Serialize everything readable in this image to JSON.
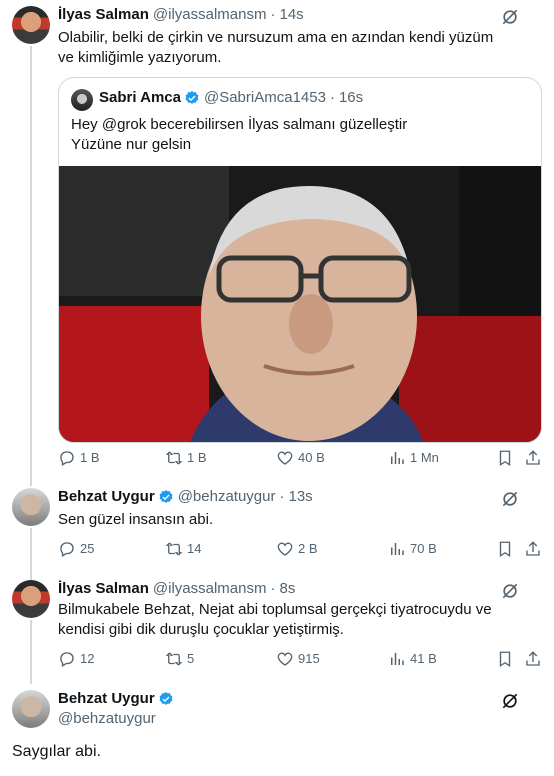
{
  "colors": {
    "text": "#0f1419",
    "secondary": "#536471",
    "border": "#cfd9de",
    "verified": "#1d9bf0"
  },
  "tweets": [
    {
      "name": "İlyas Salman",
      "handle": "@ilyassalmansm",
      "dot": "·",
      "time": "14s",
      "text": "Olabilir, belki de çirkin ve nursuzum ama en azından kendi yüzüm ve kimliğimle yazıyorum.",
      "quote": {
        "name": "Sabri Amca",
        "handle": "@SabriAmca1453",
        "dot": "·",
        "time": "16s",
        "line1": "Hey @grok becerebilirsen  İlyas salmanı güzelleştir",
        "line2": "Yüzüne nur gelsin"
      },
      "stats": {
        "replies": "1 B",
        "reposts": "1 B",
        "likes": "40 B",
        "views": "1 Mn"
      }
    },
    {
      "name": "Behzat Uygur",
      "handle": "@behzatuygur",
      "dot": "·",
      "time": "13s",
      "text": "Sen güzel insansın abi.",
      "stats": {
        "replies": "25",
        "reposts": "14",
        "likes": "2 B",
        "views": "70 B"
      }
    },
    {
      "name": "İlyas Salman",
      "handle": "@ilyassalmansm",
      "dot": "·",
      "time": "8s",
      "text": "Bilmukabele Behzat, Nejat abi toplumsal gerçekçi tiyatrocuydu ve kendisi gibi dik duruşlu çocuklar yetiştirmiş.",
      "stats": {
        "replies": "12",
        "reposts": "5",
        "likes": "915",
        "views": "41 B"
      }
    },
    {
      "name": "Behzat Uygur",
      "handle": "@behzatuygur",
      "text": "Saygılar abi."
    }
  ],
  "icons": [
    "grok-icon",
    "reply-icon",
    "repost-icon",
    "like-icon",
    "views-icon",
    "bookmark-icon",
    "share-icon",
    "verified-badge-icon"
  ]
}
